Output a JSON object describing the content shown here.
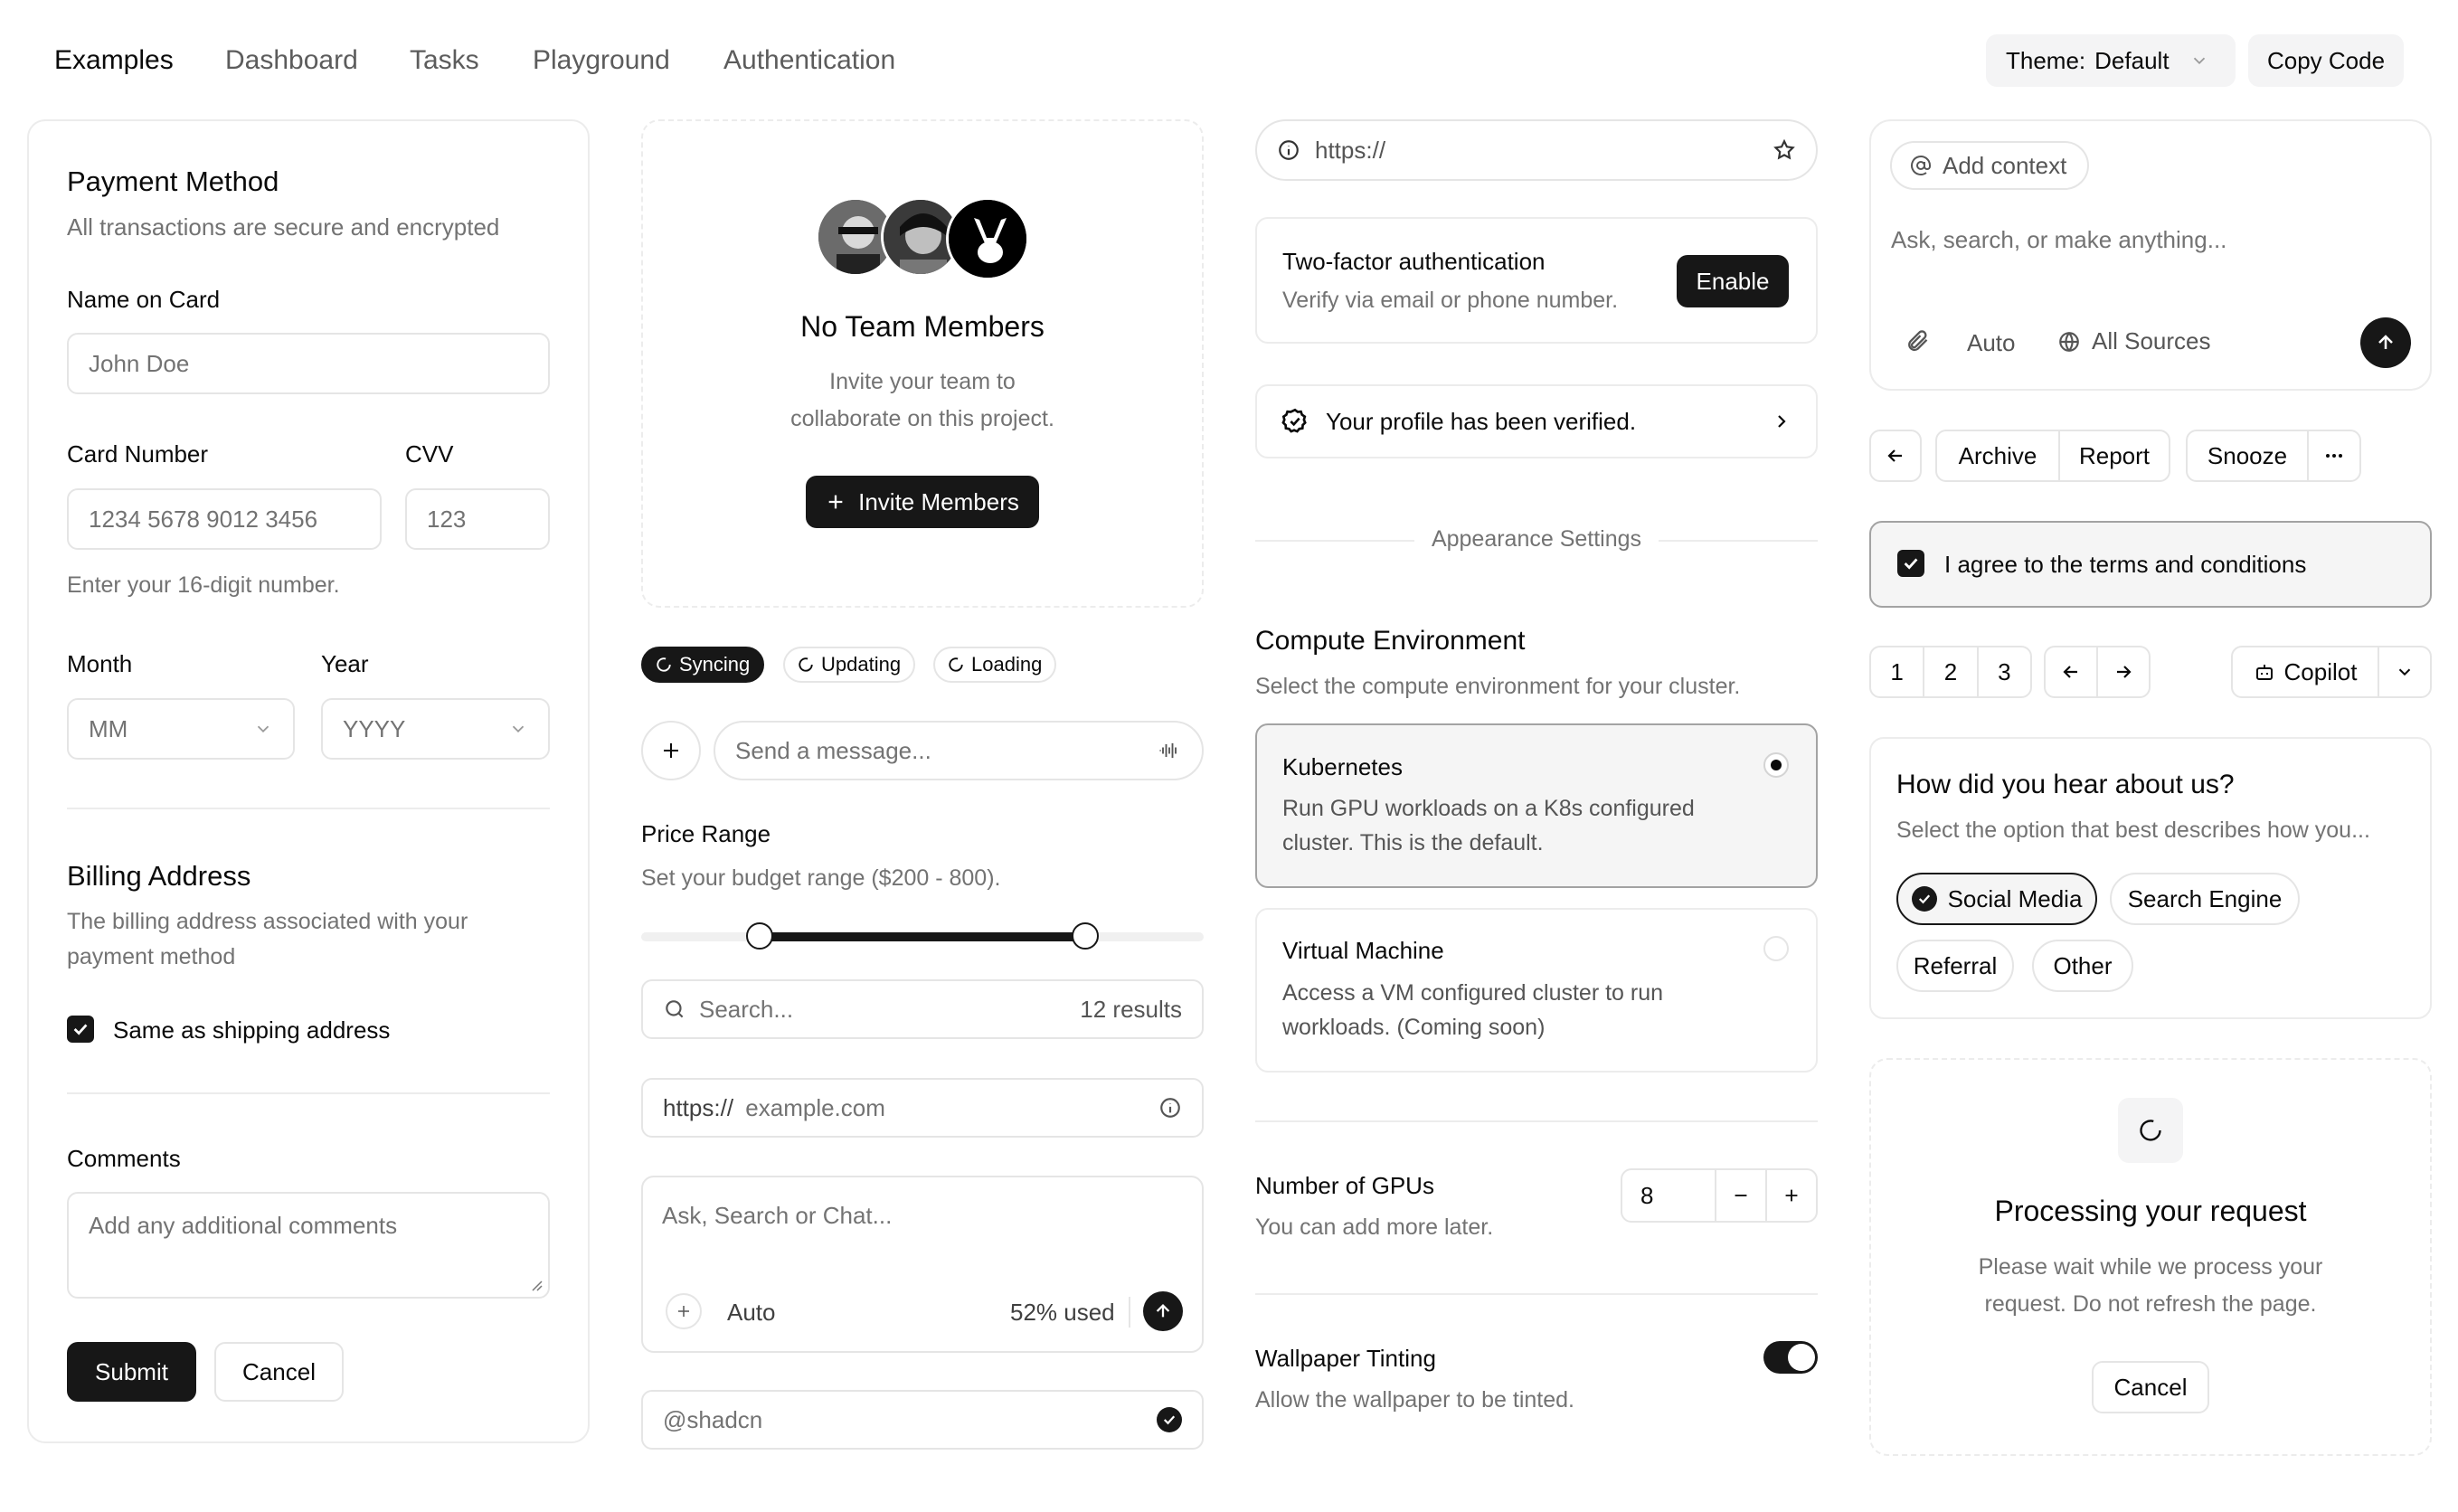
{
  "nav": {
    "items": [
      "Examples",
      "Dashboard",
      "Tasks",
      "Playground",
      "Authentication"
    ],
    "theme_label": "Theme:",
    "theme_value": "Default",
    "copy_code": "Copy Code"
  },
  "payment": {
    "title": "Payment Method",
    "subtitle": "All transactions are secure and encrypted",
    "name_label": "Name on Card",
    "name_placeholder": "John Doe",
    "card_label": "Card Number",
    "card_placeholder": "1234 5678 9012 3456",
    "cvv_label": "CVV",
    "cvv_placeholder": "123",
    "card_help": "Enter your 16-digit number.",
    "month_label": "Month",
    "month_placeholder": "MM",
    "year_label": "Year",
    "year_placeholder": "YYYY",
    "billing_title": "Billing Address",
    "billing_desc_1": "The billing address associated with your",
    "billing_desc_2": "payment method",
    "same_shipping": "Same as shipping address",
    "comments_label": "Comments",
    "comments_placeholder": "Add any additional comments",
    "submit": "Submit",
    "cancel": "Cancel"
  },
  "team": {
    "title": "No Team Members",
    "desc_1": "Invite your team to",
    "desc_2": "collaborate on this project.",
    "invite": "Invite Members"
  },
  "badges": [
    "Syncing",
    "Updating",
    "Loading"
  ],
  "message": {
    "placeholder": "Send a message..."
  },
  "price": {
    "title": "Price Range",
    "desc": "Set your budget range ($200 - 800).",
    "low_fraction": 0.21,
    "high_fraction": 0.79
  },
  "search": {
    "placeholder": "Search...",
    "results": "12 results"
  },
  "url": {
    "prefix": "https://",
    "placeholder": "example.com"
  },
  "chat": {
    "placeholder": "Ask, Search or Chat...",
    "mode": "Auto",
    "usage": "52% used"
  },
  "handle": {
    "value": "@shadcn"
  },
  "browser": {
    "url": "https://"
  },
  "twofa": {
    "title": "Two-factor authentication",
    "desc": "Verify via email or phone number.",
    "button": "Enable"
  },
  "verified": {
    "text": "Your profile has been verified."
  },
  "appearance": {
    "heading": "Appearance Settings"
  },
  "compute": {
    "title": "Compute Environment",
    "desc": "Select the compute environment for your cluster.",
    "options": [
      {
        "title": "Kubernetes",
        "desc_1": "Run GPU workloads on a K8s configured",
        "desc_2": "cluster. This is the default.",
        "selected": true
      },
      {
        "title": "Virtual Machine",
        "desc_1": "Access a VM configured cluster to run",
        "desc_2": "workloads. (Coming soon)",
        "selected": false
      }
    ]
  },
  "gpus": {
    "title": "Number of GPUs",
    "desc": "You can add more later.",
    "value": "8"
  },
  "wallpaper": {
    "title": "Wallpaper Tinting",
    "desc": "Allow the wallpaper to be tinted.",
    "enabled": true
  },
  "context": {
    "add_context": "Add context",
    "placeholder": "Ask, search, or make anything...",
    "mode": "Auto",
    "sources": "All Sources"
  },
  "actions": {
    "archive": "Archive",
    "report": "Report",
    "snooze": "Snooze"
  },
  "terms": {
    "text": "I agree to the terms and conditions"
  },
  "pagination": {
    "pages": [
      "1",
      "2",
      "3"
    ],
    "copilot": "Copilot"
  },
  "survey": {
    "title": "How did you hear about us?",
    "desc": "Select the option that best describes how you...",
    "options": [
      "Social Media",
      "Search Engine",
      "Referral",
      "Other"
    ],
    "selected": "Social Media"
  },
  "processing": {
    "title": "Processing your request",
    "desc_1": "Please wait while we process your",
    "desc_2": "request. Do not refresh the page.",
    "cancel": "Cancel"
  }
}
